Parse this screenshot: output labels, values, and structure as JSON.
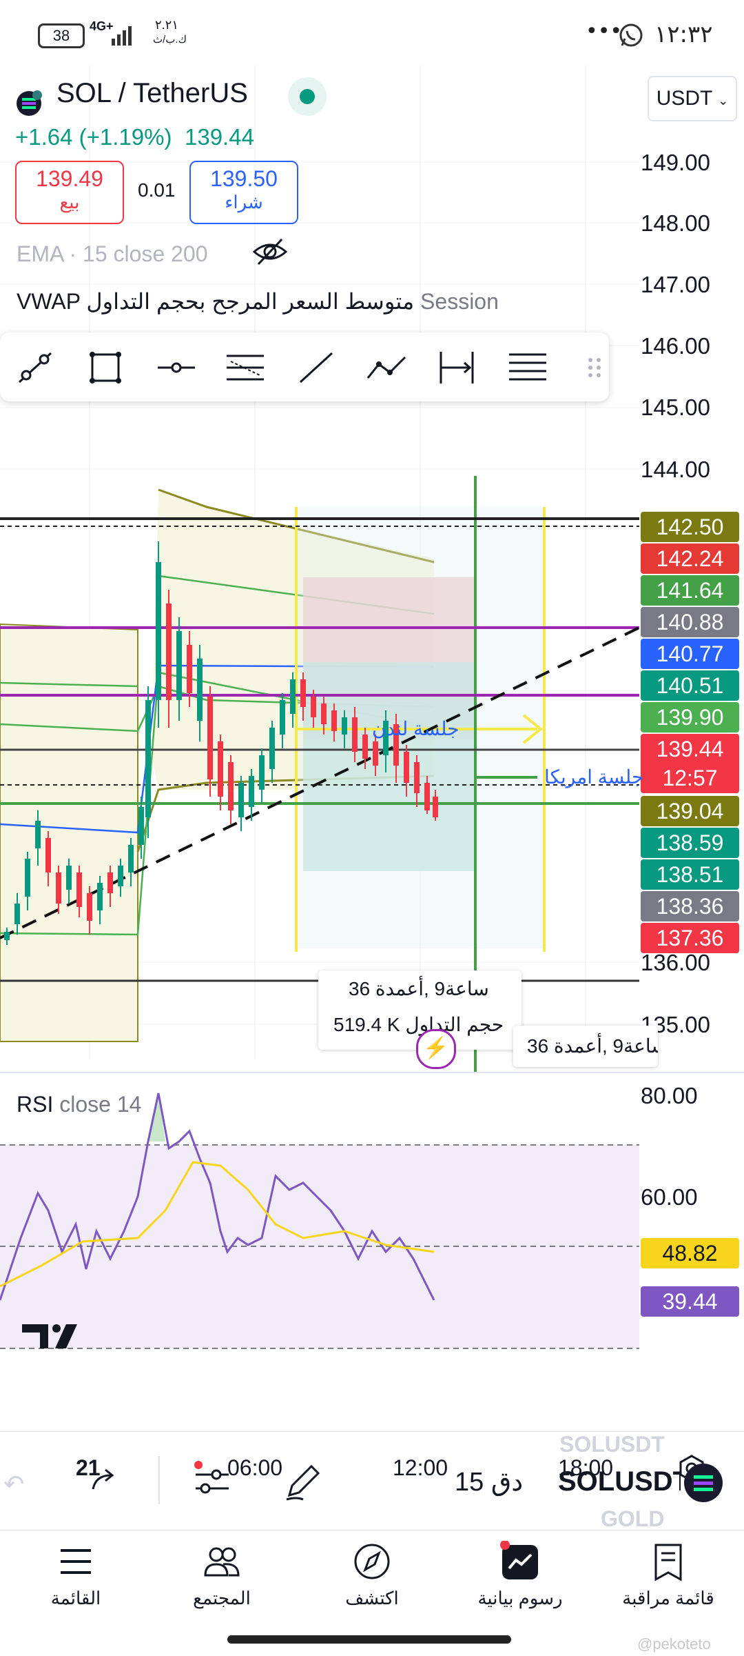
{
  "status_bar": {
    "time": "١٢:٣٢",
    "battery": "38",
    "network": "4G+",
    "speed": "٢.٢١",
    "speed_unit": "ك.ب/ث",
    "dots": "•••"
  },
  "header": {
    "symbol": "SOL / TetherUS",
    "change": "+1.64 (+1.19%)",
    "price": "139.44",
    "currency": "USDT",
    "sell_price": "139.49",
    "sell_label": "بيع",
    "spread": "0.01",
    "buy_price": "139.50",
    "buy_label": "شراء"
  },
  "indicators": {
    "ema": "EMA · 15 close 200",
    "vwap_prefix": "VWAP",
    "vwap_text": "متوسط السعر المرجح بحجم التداول",
    "vwap_suffix": "Session",
    "rsi_name": "RSI",
    "rsi_params": "close 14"
  },
  "price_axis": [
    "149.00",
    "148.00",
    "147.00",
    "146.00",
    "145.00",
    "144.00",
    "136.00",
    "135.00"
  ],
  "price_tags": [
    {
      "value": "142.50",
      "color": "#7a7a10"
    },
    {
      "value": "142.24",
      "color": "#e53935"
    },
    {
      "value": "141.64",
      "color": "#43a047"
    },
    {
      "value": "140.88",
      "color": "#787b86"
    },
    {
      "value": "140.77",
      "color": "#2962ff"
    },
    {
      "value": "140.51",
      "color": "#089981"
    },
    {
      "value": "139.90",
      "color": "#4caf50"
    },
    {
      "value": "139.44",
      "color": "#f23645"
    },
    {
      "value": "12:57",
      "color": "#f23645"
    },
    {
      "value": "139.04",
      "color": "#7a7a10"
    },
    {
      "value": "138.59",
      "color": "#089981"
    },
    {
      "value": "138.51",
      "color": "#089981"
    },
    {
      "value": "138.36",
      "color": "#787b86"
    },
    {
      "value": "137.36",
      "color": "#f23645"
    }
  ],
  "rsi_axis": [
    "80.00",
    "60.00"
  ],
  "rsi_tags": [
    {
      "value": "48.82",
      "color": "#f7d51d",
      "text": "#131722"
    },
    {
      "value": "39.44",
      "color": "#7e57c2",
      "text": "#ffffff"
    }
  ],
  "time_axis": [
    "21",
    "06:00",
    "12:00",
    "18:00"
  ],
  "annotations": {
    "london": "جلسة لندن",
    "america": "جلسة امريكا",
    "tooltip_line1": "ساعة9 ,أعمدة 36",
    "tooltip_line2": "519.4 K حجم التداول",
    "tooltip2": "ساعة9 ,أعمدة 36"
  },
  "controls": {
    "interval": "15 دق",
    "symbol": "SOLUSDT",
    "symbol_above": "SOLUSDT",
    "symbol_below": "GOLD"
  },
  "nav": [
    {
      "label": "القائمة",
      "icon": "menu-icon"
    },
    {
      "label": "المجتمع",
      "icon": "community-icon"
    },
    {
      "label": "اكتشف",
      "icon": "compass-icon"
    },
    {
      "label": "رسوم بيانية",
      "icon": "chart-icon"
    },
    {
      "label": "قائمة مراقبة",
      "icon": "watchlist-icon"
    }
  ],
  "watermark": "@pekoteto"
}
